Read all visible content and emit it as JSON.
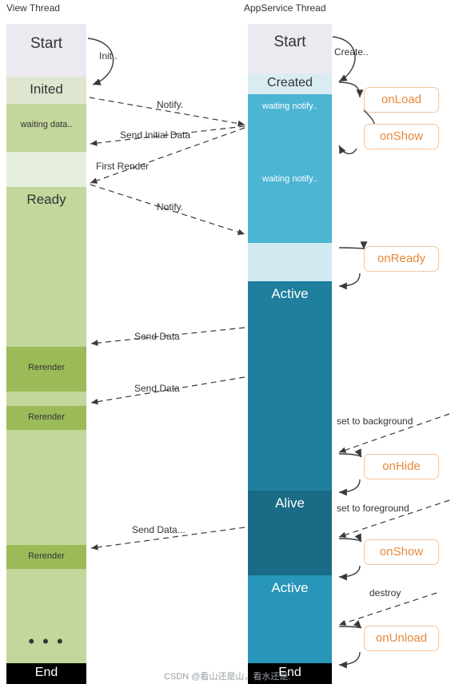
{
  "columns": {
    "view": {
      "title": "View Thread"
    },
    "service": {
      "title": "AppService Thread"
    }
  },
  "view_blocks": [
    {
      "label": "Start",
      "size": "large"
    },
    {
      "label": "Inited",
      "size": "large"
    },
    {
      "label": "waiting data..",
      "size": "small"
    },
    {
      "label": "",
      "size": "small"
    },
    {
      "label": "Ready",
      "size": "large"
    },
    {
      "label": "Rerender",
      "size": "small"
    },
    {
      "label": "Rerender",
      "size": "small"
    },
    {
      "label": "Rerender",
      "size": "small"
    },
    {
      "label": "End",
      "size": "large"
    }
  ],
  "service_blocks": [
    {
      "label": "Start",
      "size": "large"
    },
    {
      "label": "Created",
      "size": "large"
    },
    {
      "label": "waiting notify..",
      "size": "small"
    },
    {
      "label": "waiting notify..",
      "size": "small"
    },
    {
      "label": "",
      "size": "small"
    },
    {
      "label": "Active",
      "size": "large"
    },
    {
      "label": "Alive",
      "size": "large"
    },
    {
      "label": "Active",
      "size": "large"
    },
    {
      "label": "End",
      "size": "large"
    }
  ],
  "callbacks": [
    {
      "label": "onLoad"
    },
    {
      "label": "onShow"
    },
    {
      "label": "onReady"
    },
    {
      "label": "onHide"
    },
    {
      "label": "onShow"
    },
    {
      "label": "onUnload"
    }
  ],
  "arrow_labels": {
    "init": "Init..",
    "create": "Create..",
    "notify1": "Notify.",
    "send_initial": "Send Initial Data",
    "first_render": "First Render",
    "notify2": "Notify.",
    "send_data_1": "Send Data",
    "send_data_2": "Send Data",
    "set_background": "set to background",
    "set_foreground": "set to foreground",
    "send_data_3": "Send Data...",
    "destroy": "destroy"
  },
  "ellipsis": "• • •",
  "watermark": "CSDN @看山还是山，看水还是.",
  "colors": {
    "callback_accent": "#e8883a",
    "view_block": "#c3d69b",
    "view_rerender": "#9bbb59",
    "service_active": "#1f7f9c",
    "service_waiting": "#4cb5d3"
  }
}
